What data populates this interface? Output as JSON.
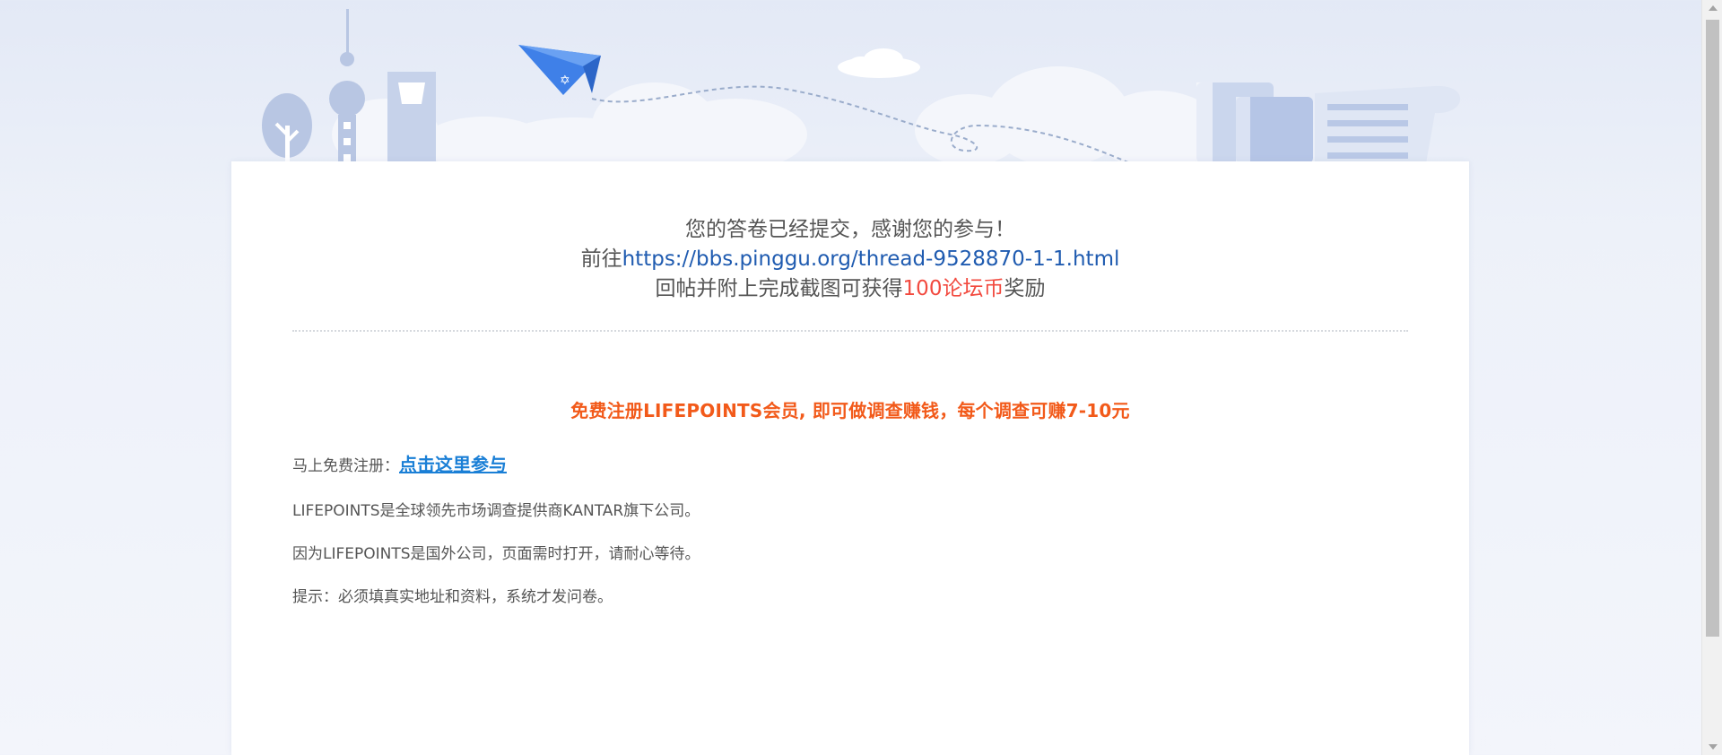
{
  "banner": {
    "illustrations": [
      "tree-icon",
      "tv-tower-icon",
      "skyscraper-icon",
      "paper-plane-icon",
      "cloud-icon",
      "books-icon",
      "scroll-paper-icon"
    ]
  },
  "thanks": {
    "line1": "您的答卷已经提交，感谢您的参与！",
    "line2_prefix": "前往",
    "line2_link": "https://bbs.pinggu.org/thread-9528870-1-1.html",
    "line3_prefix": "回帖并附上完成截图可获得",
    "line3_reward": "100论坛币",
    "line3_suffix": "奖励"
  },
  "promo": {
    "headline": "免费注册LIFEPOINTS会员, 即可做调查赚钱，每个调查可赚7-10元"
  },
  "info": {
    "register_label": "马上免费注册：",
    "register_link": "点击这里参与",
    "line_company": "LIFEPOINTS是全球领先市场调查提供商KANTAR旗下公司。",
    "line_loading": "因为LIFEPOINTS是国外公司，页面需时打开，请耐心等待。",
    "line_tip": "提示：必须填真实地址和资料，系统才发问卷。"
  },
  "colors": {
    "link_blue": "#1f5bb0",
    "reward_red": "#f24a3f",
    "promo_orange": "#f25a1a",
    "join_link_blue": "#1a7fd6"
  }
}
